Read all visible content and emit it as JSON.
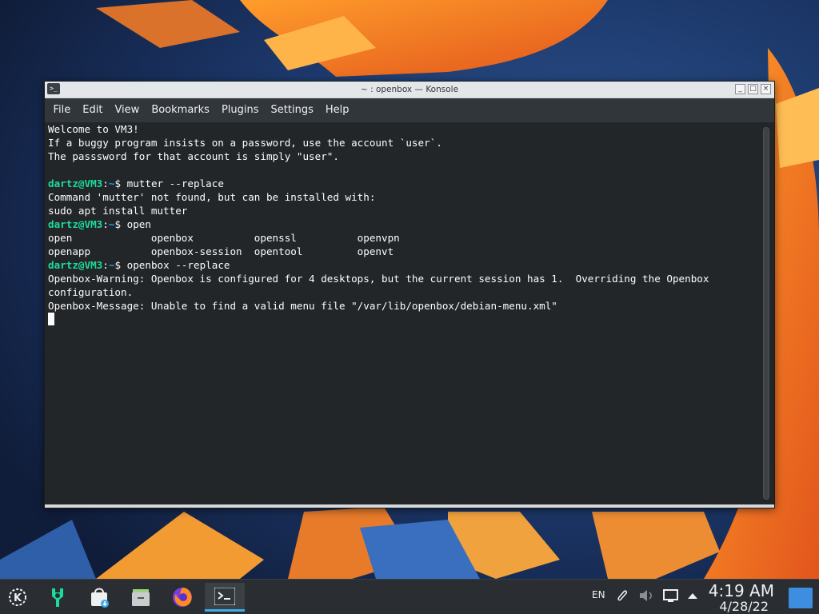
{
  "window": {
    "title": "~ : openbox — Konsole",
    "buttons": {
      "minimize": "_",
      "maximize": "□",
      "close": "×"
    }
  },
  "menu": [
    "File",
    "Edit",
    "View",
    "Bookmarks",
    "Plugins",
    "Settings",
    "Help"
  ],
  "terminal": {
    "lines": [
      {
        "text": "Welcome to VM3!"
      },
      {
        "text": "If a buggy program insists on a password, use the account `user`."
      },
      {
        "text": "The passsword for that account is simply \"user\"."
      },
      {
        "text": ""
      },
      {
        "prompt_user": "dartz@VM3",
        "prompt_path": "~",
        "command": "mutter --replace"
      },
      {
        "text": "Command 'mutter' not found, but can be installed with:"
      },
      {
        "text": "sudo apt install mutter"
      },
      {
        "prompt_user": "dartz@VM3",
        "prompt_path": "~",
        "command": "open"
      },
      {
        "text": "open             openbox          openssl          openvpn"
      },
      {
        "text": "openapp          openbox-session  opentool         openvt"
      },
      {
        "prompt_user": "dartz@VM3",
        "prompt_path": "~",
        "command": "openbox --replace"
      },
      {
        "text": "Openbox-Warning: Openbox is configured for 4 desktops, but the current session has 1.  Overriding the Openbox"
      },
      {
        "text": "configuration."
      },
      {
        "text": "Openbox-Message: Unable to find a valid menu file \"/var/lib/openbox/debian-menu.xml\""
      }
    ]
  },
  "taskbar": {
    "apps": [
      {
        "name": "kde-launcher-icon"
      },
      {
        "name": "discover-icon"
      },
      {
        "name": "store-bag-icon"
      },
      {
        "name": "file-manager-icon"
      },
      {
        "name": "firefox-icon"
      },
      {
        "name": "konsole-icon"
      }
    ],
    "tray": {
      "language": "EN"
    },
    "clock": {
      "time": "4:19 AM",
      "date": "4/28/22"
    }
  },
  "colors": {
    "prompt_user": "#1cdc9a",
    "prompt_path": "#1d99f3",
    "accent": "#3daee9"
  }
}
